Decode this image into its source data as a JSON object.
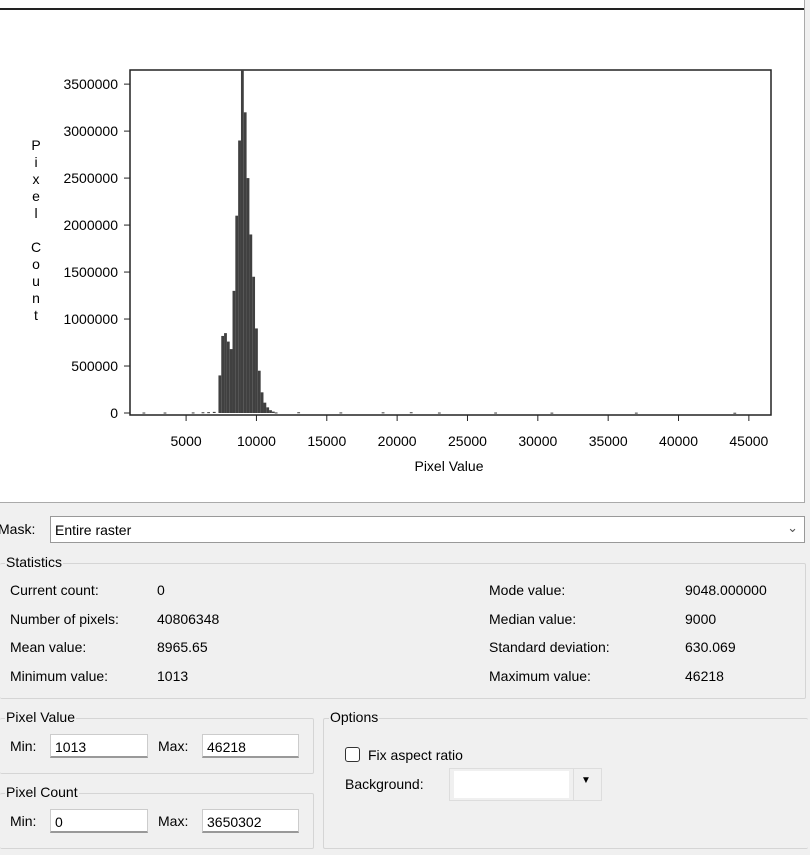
{
  "mask": {
    "label": "Mask:",
    "value": "Entire raster"
  },
  "statistics": {
    "title": "Statistics",
    "left": [
      {
        "label": "Current count:",
        "value": "0"
      },
      {
        "label": "Number of pixels:",
        "value": "40806348"
      },
      {
        "label": "Mean value:",
        "value": "8965.65"
      },
      {
        "label": "Minimum value:",
        "value": "1013"
      }
    ],
    "right": [
      {
        "label": "Mode value:",
        "value": "9048.000000"
      },
      {
        "label": "Median value:",
        "value": "9000"
      },
      {
        "label": "Standard deviation:",
        "value": "630.069"
      },
      {
        "label": "Maximum value:",
        "value": "46218"
      }
    ]
  },
  "pixel_value": {
    "title": "Pixel Value",
    "min_label": "Min:",
    "min": "1013",
    "max_label": "Max:",
    "max": "46218"
  },
  "pixel_count": {
    "title": "Pixel Count",
    "min_label": "Min:",
    "min": "0",
    "max_label": "Max:",
    "max": "3650302"
  },
  "options": {
    "title": "Options",
    "fix_aspect_label": "Fix aspect ratio",
    "fix_aspect_checked": false,
    "background_label": "Background:",
    "background_value": ""
  },
  "chart_data": {
    "type": "bar",
    "title": "",
    "xlabel": "Pixel Value",
    "ylabel": "Pixel Count",
    "xlim": [
      1013,
      46218
    ],
    "ylim": [
      0,
      3650302
    ],
    "xticks": [
      5000,
      10000,
      15000,
      20000,
      25000,
      30000,
      35000,
      40000,
      45000
    ],
    "yticks": [
      0,
      500000,
      1000000,
      1500000,
      2000000,
      2500000,
      3000000,
      3500000
    ],
    "bin_width": 200,
    "x": [
      2000,
      3500,
      5500,
      6200,
      6600,
      7000,
      7400,
      7600,
      7800,
      8000,
      8200,
      8400,
      8600,
      8800,
      9000,
      9200,
      9400,
      9600,
      9800,
      10000,
      10200,
      10400,
      10600,
      10800,
      11000,
      11200,
      11400,
      13000,
      16000,
      19000,
      21000,
      23000,
      27000,
      31000,
      37000,
      44000
    ],
    "values": [
      5000,
      5000,
      6000,
      8000,
      9000,
      12000,
      400000,
      820000,
      850000,
      760000,
      680000,
      1300000,
      2100000,
      2900000,
      3650302,
      3200000,
      2500000,
      1900000,
      1450000,
      900000,
      450000,
      220000,
      110000,
      60000,
      30000,
      15000,
      6000,
      8000,
      6000,
      7000,
      8000,
      5000,
      5000,
      4000,
      4000,
      3000
    ],
    "grid": false,
    "legend": "none"
  }
}
